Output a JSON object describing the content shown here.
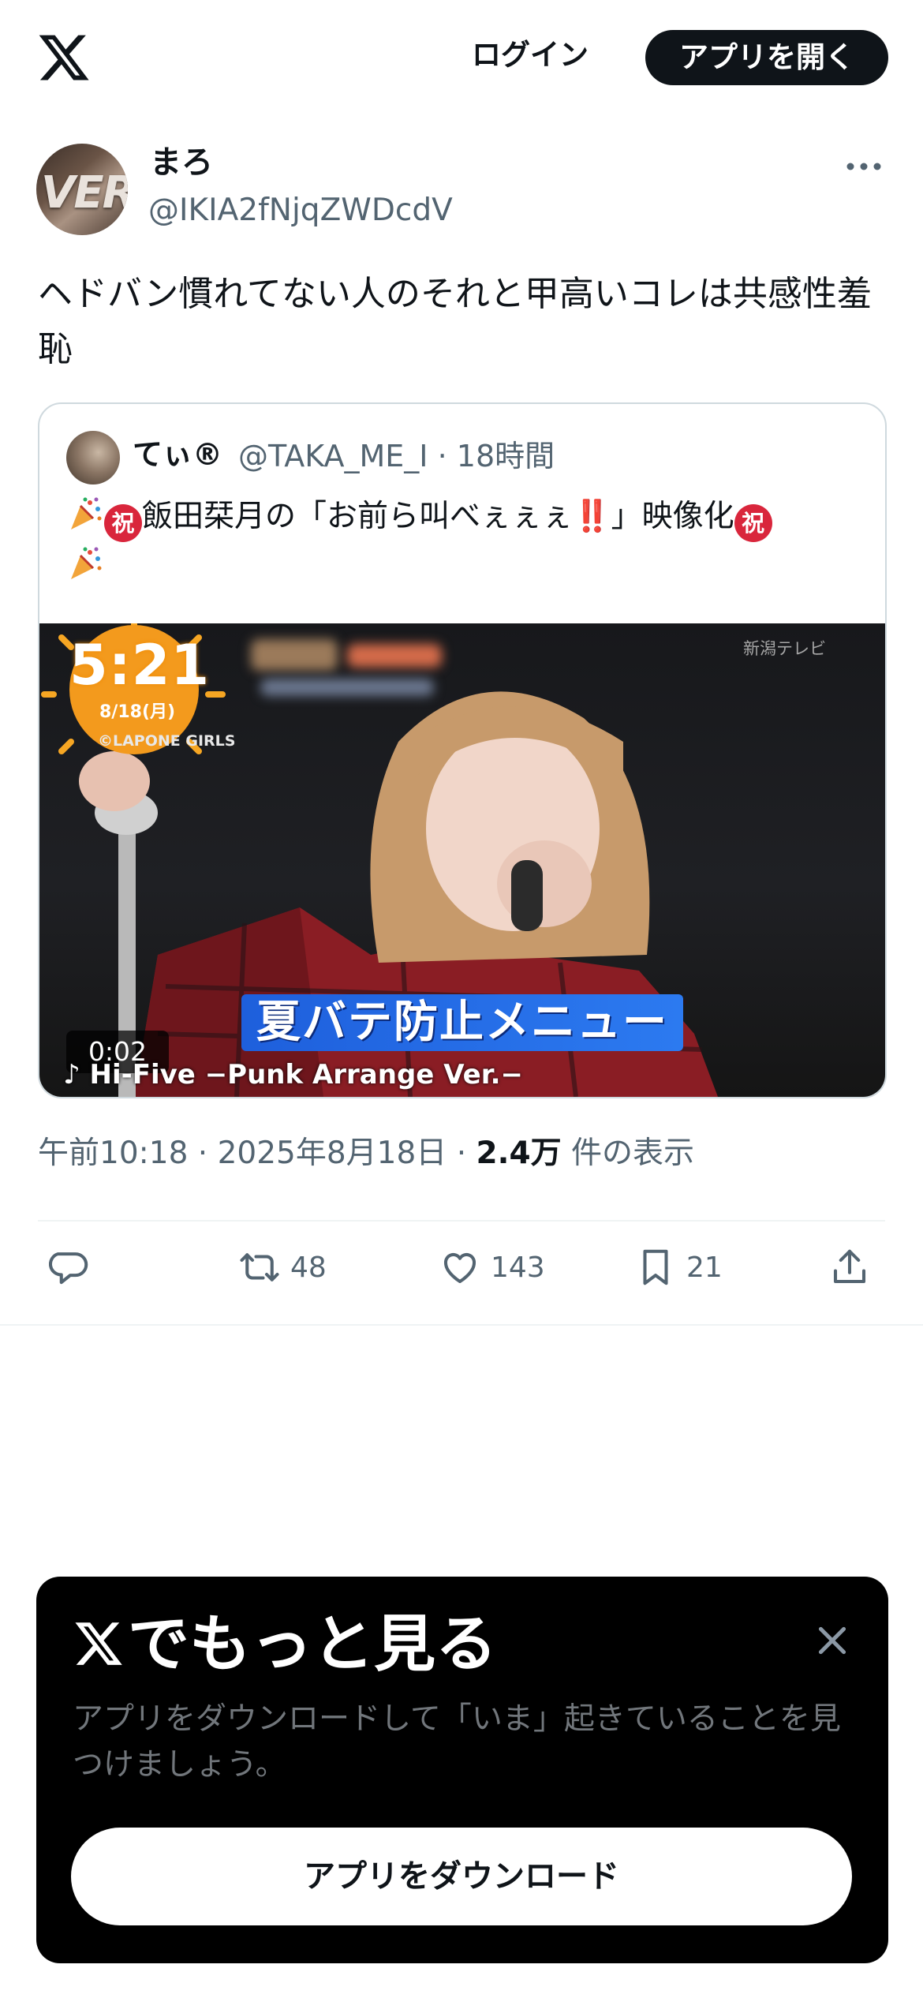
{
  "header": {
    "logo_icon": "x-logo-icon",
    "login_label": "ログイン",
    "open_app_label": "アプリを開く"
  },
  "tweet": {
    "author_name": "まろ",
    "author_handle": "@IKIA2fNjqZWDcdV",
    "avatar_text": "VER",
    "text": "ヘドバン慣れてない人のそれと甲高いコレは共感性羞恥",
    "time": "午前10:18",
    "date": "2025年8月18日",
    "views_count": "2.4万",
    "views_label": "件の表示",
    "separator": " · "
  },
  "quote": {
    "author_name": "てぃ®",
    "author_handle": "@TAKA_ME_I",
    "age": "18時間",
    "iwai_char": "祝",
    "text_main": "飯田栞月の「お前ら叫べぇぇぇ",
    "text_exclaim": "‼️",
    "text_end": "」映像化"
  },
  "video": {
    "clock_time": "5:21",
    "clock_date": "8/18(月)",
    "copyright": "©LAPONE GIRLS",
    "channel": "新潟テレビ",
    "caption": "夏バテ防止メニュー",
    "song": "♪ Hi-Five −Punk Arrange Ver.−",
    "duration": "0:02"
  },
  "actions": {
    "reply_count": "",
    "retweet_count": "48",
    "like_count": "143",
    "bookmark_count": "21"
  },
  "promo": {
    "title": "でもっと見る",
    "description": "アプリをダウンロードして「いま」起きていることを見つけましょう。",
    "button_label": "アプリをダウンロード"
  },
  "colors": {
    "text_primary": "#0f1419",
    "text_secondary": "#536471",
    "border": "#cfd9de",
    "sheet_bg": "#000000",
    "iwai_red": "#d9263c"
  }
}
